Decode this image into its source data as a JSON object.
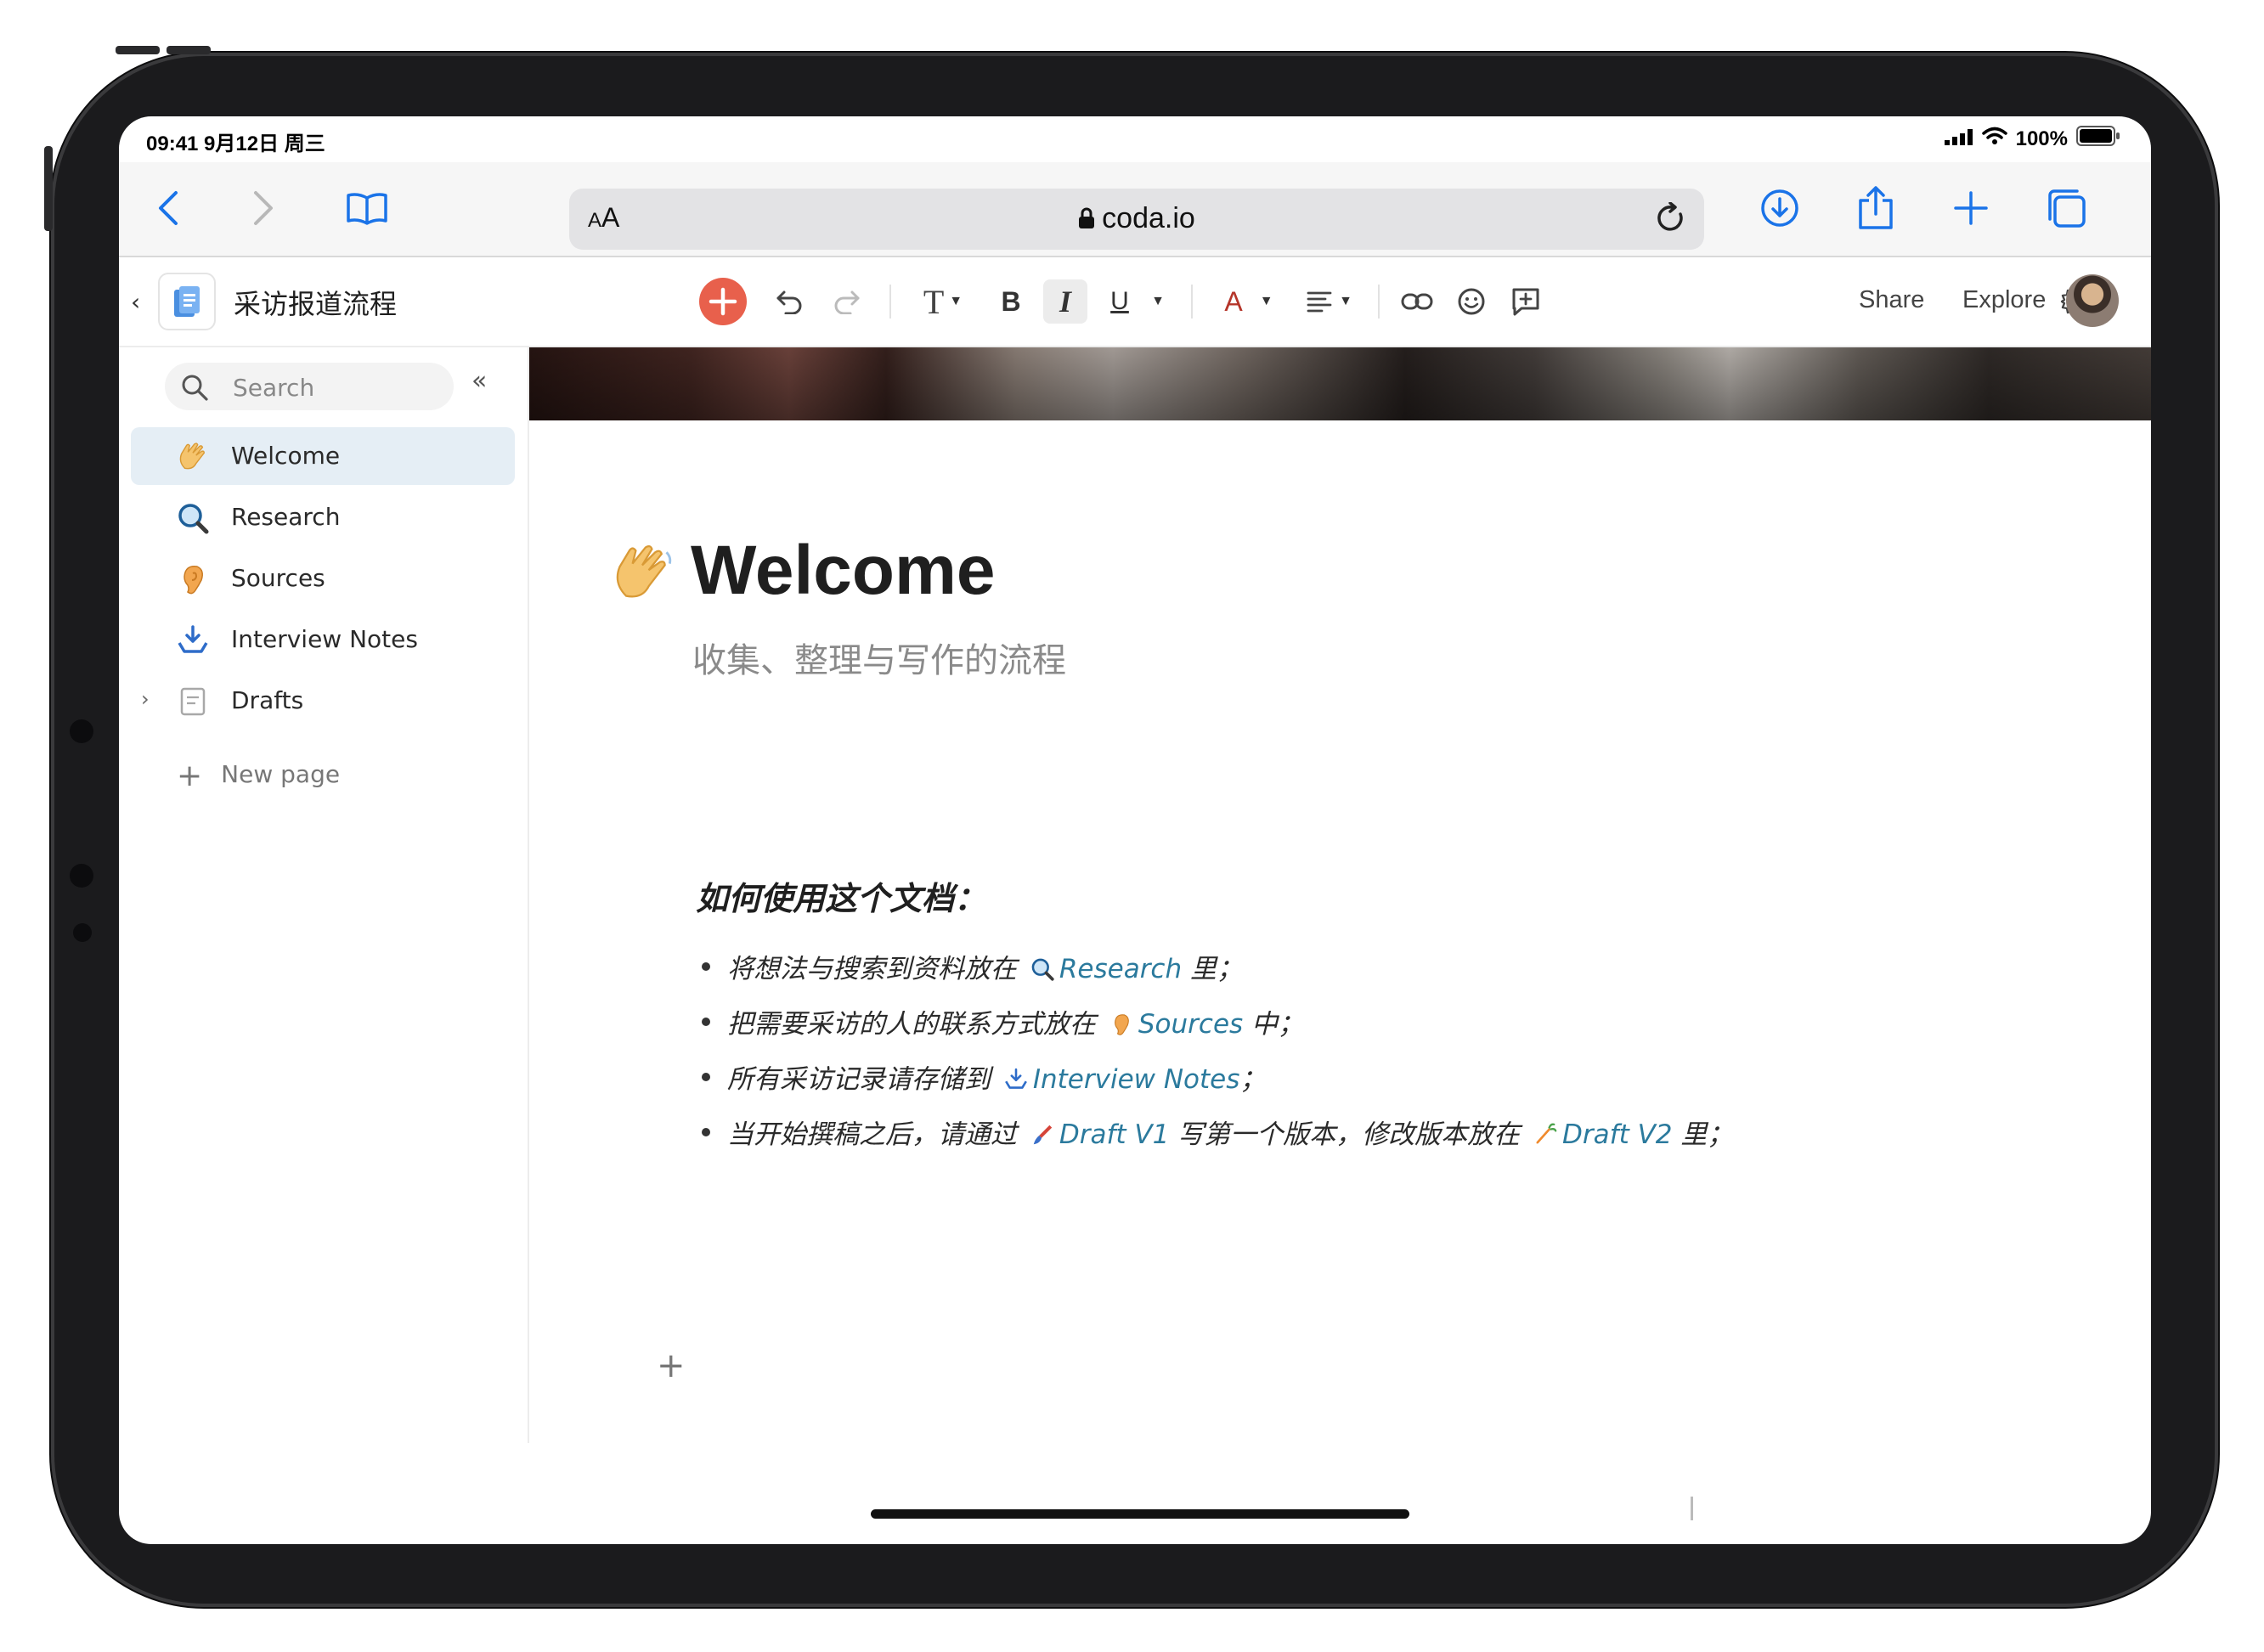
{
  "status_bar": {
    "time": "09:41 9月12日 周三",
    "battery": "100%"
  },
  "safari": {
    "aa_label": "AA",
    "url": "coda.io"
  },
  "doc": {
    "title": "采访报道流程"
  },
  "toolbar": {
    "share": "Share",
    "explore": "Explore",
    "text_style_label": "T",
    "bold_label": "B",
    "italic_label": "I",
    "underline_label": "U",
    "text_color_label": "A"
  },
  "sidebar": {
    "search_placeholder": "Search",
    "items": [
      {
        "label": "Welcome",
        "icon": "waving-hand-icon",
        "active": true
      },
      {
        "label": "Research",
        "icon": "magnifier-icon",
        "active": false
      },
      {
        "label": "Sources",
        "icon": "ear-icon",
        "active": false
      },
      {
        "label": "Interview Notes",
        "icon": "inbox-icon",
        "active": false
      },
      {
        "label": "Drafts",
        "icon": "page-icon",
        "active": false
      }
    ],
    "new_page": "New page"
  },
  "page": {
    "title": "Welcome",
    "subtitle": "收集、整理与写作的流程",
    "section_heading": "如何使用这个文档：",
    "bullets": [
      {
        "before": "将想法与搜索到资料放在 ",
        "link": "Research",
        "after": " 里；"
      },
      {
        "before": "把需要采访的人的联系方式放在 ",
        "link": "Sources",
        "after": " 中；"
      },
      {
        "before": "所有采访记录请存储到 ",
        "link": "Interview Notes",
        "after": "；"
      },
      {
        "before": "当开始撰稿之后，请通过 ",
        "link": "Draft V1",
        "middle": " 写第一个版本，修改版本放在 ",
        "link2": "Draft V2",
        "after": " 里；"
      }
    ]
  },
  "colors": {
    "accent_red": "#e8604c",
    "link": "#2b7a9d",
    "active_nav": "#e5eef5",
    "ios_blue": "#1a73e8"
  }
}
